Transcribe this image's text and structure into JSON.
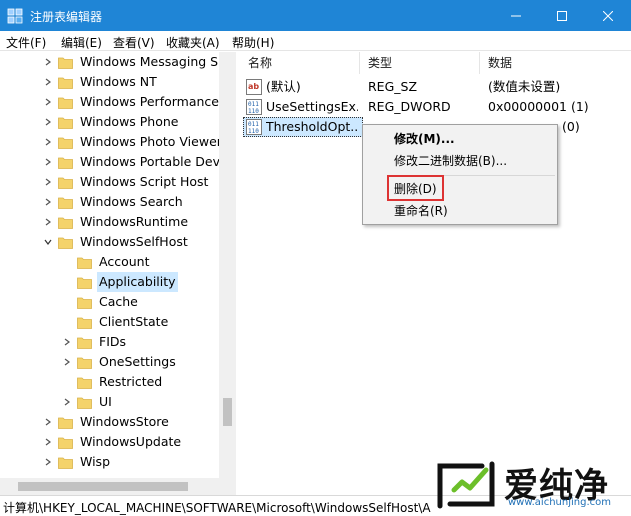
{
  "window": {
    "title": "注册表编辑器"
  },
  "menu": [
    "文件(F)",
    "编辑(E)",
    "查看(V)",
    "收藏夹(A)",
    "帮助(H)"
  ],
  "tree": [
    {
      "label": "Windows Messaging Su",
      "level": 1,
      "expander": "collapsed"
    },
    {
      "label": "Windows NT",
      "level": 1,
      "expander": "collapsed"
    },
    {
      "label": "Windows Performance T",
      "level": 1,
      "expander": "collapsed"
    },
    {
      "label": "Windows Phone",
      "level": 1,
      "expander": "collapsed"
    },
    {
      "label": "Windows Photo Viewer",
      "level": 1,
      "expander": "collapsed"
    },
    {
      "label": "Windows Portable Devic",
      "level": 1,
      "expander": "collapsed"
    },
    {
      "label": "Windows Script Host",
      "level": 1,
      "expander": "collapsed"
    },
    {
      "label": "Windows Search",
      "level": 1,
      "expander": "collapsed"
    },
    {
      "label": "WindowsRuntime",
      "level": 1,
      "expander": "collapsed"
    },
    {
      "label": "WindowsSelfHost",
      "level": 1,
      "expander": "expanded"
    },
    {
      "label": "Account",
      "level": 2,
      "expander": "none"
    },
    {
      "label": "Applicability",
      "level": 2,
      "expander": "none",
      "selected": true
    },
    {
      "label": "Cache",
      "level": 2,
      "expander": "none"
    },
    {
      "label": "ClientState",
      "level": 2,
      "expander": "none"
    },
    {
      "label": "FIDs",
      "level": 2,
      "expander": "collapsed"
    },
    {
      "label": "OneSettings",
      "level": 2,
      "expander": "collapsed"
    },
    {
      "label": "Restricted",
      "level": 2,
      "expander": "none"
    },
    {
      "label": "UI",
      "level": 2,
      "expander": "collapsed"
    },
    {
      "label": "WindowsStore",
      "level": 1,
      "expander": "collapsed"
    },
    {
      "label": "WindowsUpdate",
      "level": 1,
      "expander": "collapsed"
    },
    {
      "label": "Wisp",
      "level": 1,
      "expander": "collapsed"
    }
  ],
  "list": {
    "columns": [
      "名称",
      "类型",
      "数据"
    ],
    "rows": [
      {
        "icon": "string-value-icon",
        "name": "(默认)",
        "type": "REG_SZ",
        "data": "(数值未设置)"
      },
      {
        "icon": "binary-value-icon",
        "name": "UseSettingsEx...",
        "type": "REG_DWORD",
        "data": "0x00000001 (1)"
      },
      {
        "icon": "binary-value-icon",
        "name": "ThresholdOpt...",
        "type": "",
        "data": "(0)",
        "selected": true
      }
    ]
  },
  "context_menu": {
    "items": [
      "修改(M)...",
      "修改二进制数据(B)...",
      "删除(D)",
      "重命名(R)"
    ],
    "highlighted": "删除(D)"
  },
  "status": {
    "path": "计算机\\HKEY_LOCAL_MACHINE\\SOFTWARE\\Microsoft\\WindowsSelfHost\\A"
  },
  "watermark": {
    "brand": "爱纯净",
    "url": "www.aichunjing.com"
  },
  "colors": {
    "titlebar": "#1f85d6",
    "selection": "#cce8ff",
    "highlight_box": "#dd3333",
    "folder": "#f4d36b"
  }
}
